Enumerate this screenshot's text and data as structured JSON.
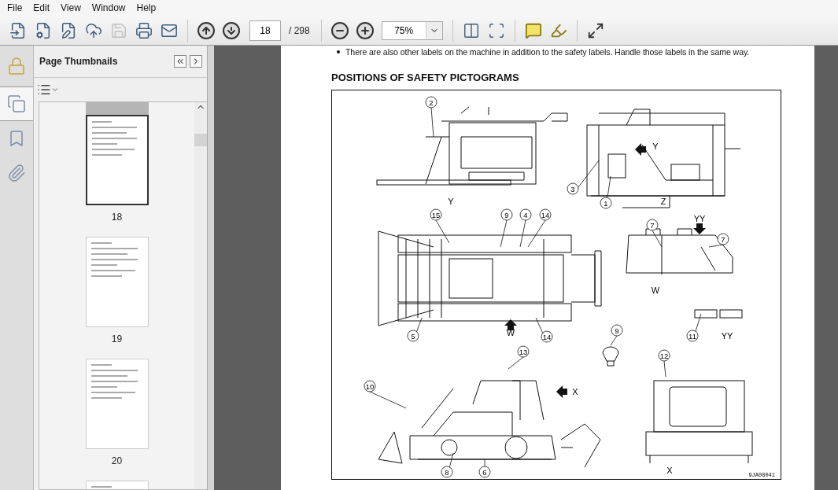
{
  "menu": [
    "File",
    "Edit",
    "View",
    "Window",
    "Help"
  ],
  "toolbar": {
    "file_tools": [
      {
        "kind": "create",
        "disabled": false
      },
      {
        "kind": "settings",
        "disabled": false
      },
      {
        "kind": "sign",
        "disabled": false
      },
      {
        "kind": "upload",
        "disabled": false
      },
      {
        "kind": "save",
        "disabled": true
      },
      {
        "kind": "print",
        "disabled": false
      },
      {
        "kind": "email",
        "disabled": false
      }
    ],
    "page": "18",
    "page_total": "/ 298",
    "zoom": "75%"
  },
  "side_tabs": [
    {
      "kind": "lock",
      "selected": false
    },
    {
      "kind": "pages",
      "selected": true
    },
    {
      "kind": "bookmarks",
      "selected": false
    },
    {
      "kind": "attachments",
      "selected": false
    }
  ],
  "thumbnails": {
    "title": "Page Thumbnails",
    "pages": [
      {
        "label": "18",
        "selected": true
      },
      {
        "label": "19",
        "selected": false
      },
      {
        "label": "20",
        "selected": false
      },
      {
        "selected": false
      }
    ]
  },
  "document": {
    "bullet": "There are also other labels on the machine in addition to the safety labels. Handle those labels in the same way.",
    "heading": "POSITIONS OF SAFETY PICTOGRAMS",
    "figure": {
      "callouts": [
        "2",
        "3",
        "1",
        "15",
        "9",
        "4",
        "14",
        "7",
        "7",
        "5",
        "14",
        "9",
        "11",
        "13",
        "10",
        "8",
        "6",
        "12"
      ],
      "view_labels": [
        "Y",
        "Z",
        "Y",
        "YY",
        "W",
        "W",
        "YY",
        "X",
        "X"
      ],
      "code": "9JA08041"
    }
  }
}
